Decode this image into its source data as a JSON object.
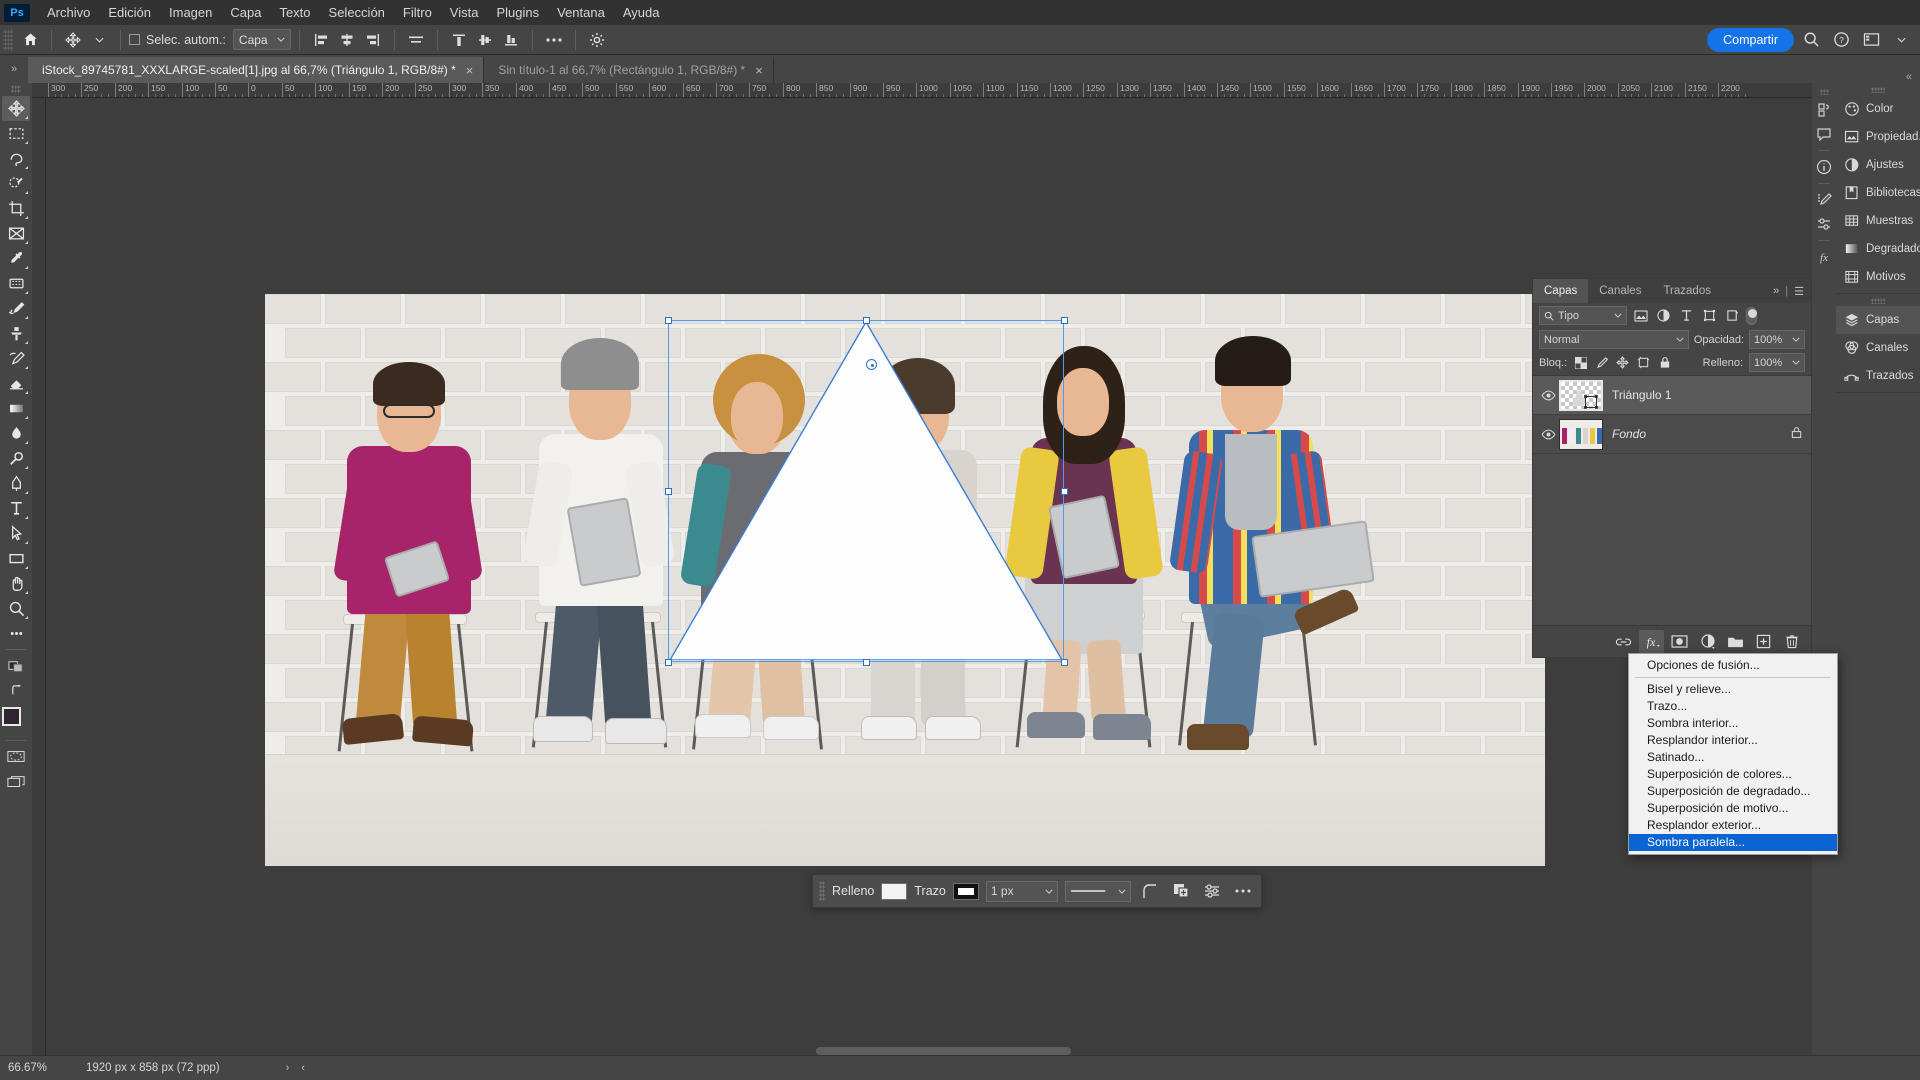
{
  "app": {
    "logo": "Ps",
    "share_label": "Compartir"
  },
  "menubar": {
    "items": [
      "Archivo",
      "Edición",
      "Imagen",
      "Capa",
      "Texto",
      "Selección",
      "Filtro",
      "Vista",
      "Plugins",
      "Ventana",
      "Ayuda"
    ]
  },
  "options_bar": {
    "home_icon": "home-icon",
    "tool_icon": "move-tool-icon",
    "auto_select_label": "Selec. autom.:",
    "auto_select_value": "Capa",
    "align_icons": [
      "align-left-icon",
      "align-center-h-icon",
      "align-right-icon",
      "distribute-h-icon",
      "align-top-icon",
      "align-center-v-icon",
      "align-bottom-icon"
    ],
    "more_icon": "more-options-icon",
    "settings_icon": "gear-icon",
    "search_icon": "search-icon",
    "help_icon": "help-icon",
    "workspace_icon": "workspace-icon"
  },
  "tabs": [
    {
      "title": "iStock_89745781_XXXLARGE-scaled[1].jpg al 66,7% (Triángulo 1, RGB/8#) *",
      "active": true,
      "close": "×"
    },
    {
      "title": "Sin título-1 al 66,7% (Rectángulo 1, RGB/8#) *",
      "active": false,
      "close": "×"
    }
  ],
  "toolbar": {
    "tools": [
      {
        "name": "move-tool",
        "glyph": "move",
        "selected": true
      },
      {
        "name": "rectangular-marquee-tool",
        "glyph": "marquee"
      },
      {
        "name": "lasso-tool",
        "glyph": "lasso"
      },
      {
        "name": "object-selection-tool",
        "glyph": "quickselect"
      },
      {
        "name": "crop-tool",
        "glyph": "crop"
      },
      {
        "name": "frame-tool",
        "glyph": "frame"
      },
      {
        "name": "eyedropper-tool",
        "glyph": "eyedropper"
      },
      {
        "name": "spot-healing-brush-tool",
        "glyph": "heal"
      },
      {
        "name": "brush-tool",
        "glyph": "brush"
      },
      {
        "name": "clone-stamp-tool",
        "glyph": "stamp"
      },
      {
        "name": "history-brush-tool",
        "glyph": "historybrush"
      },
      {
        "name": "eraser-tool",
        "glyph": "eraser"
      },
      {
        "name": "gradient-tool",
        "glyph": "gradient"
      },
      {
        "name": "blur-tool",
        "glyph": "blur"
      },
      {
        "name": "dodge-tool",
        "glyph": "dodge"
      },
      {
        "name": "pen-tool",
        "glyph": "pen"
      },
      {
        "name": "type-tool",
        "glyph": "type"
      },
      {
        "name": "path-selection-tool",
        "glyph": "pathselect"
      },
      {
        "name": "rectangle-tool",
        "glyph": "rectangle"
      },
      {
        "name": "hand-tool",
        "glyph": "hand"
      },
      {
        "name": "zoom-tool",
        "glyph": "zoom"
      },
      {
        "name": "edit-toolbar",
        "glyph": "ellipsis"
      }
    ],
    "foreground_color": "#2f2430",
    "background_color": "#fae13c"
  },
  "ruler": {
    "labels": [
      "300",
      "250",
      "200",
      "150",
      "100",
      "50",
      "0",
      "50",
      "100",
      "150",
      "200",
      "250",
      "300",
      "350",
      "400",
      "450",
      "500",
      "550",
      "600",
      "650",
      "700",
      "750",
      "800",
      "850",
      "900",
      "950",
      "1000",
      "1050",
      "1100",
      "1150",
      "1200",
      "1250",
      "1300",
      "1350",
      "1400",
      "1450",
      "1500",
      "1550",
      "1600",
      "1650",
      "1700",
      "1750",
      "1800",
      "1850",
      "1900",
      "1950",
      "2000",
      "2050",
      "2100",
      "2150",
      "2200"
    ]
  },
  "shape_options_bar": {
    "fill_label": "Relleno",
    "fill_color": "#f4f4f4",
    "stroke_label": "Trazo",
    "stroke_color": "#111111",
    "stroke_width": "1 px",
    "stroke_style_icon": "stroke-style-icon",
    "corner_icon": "corner-radius-icon",
    "path-ops_icon": "path-operations-icon",
    "align_icon": "path-align-icon",
    "more_icon": "more-shape-options-icon"
  },
  "dock": {
    "groups": [
      {
        "items": [
          {
            "label": "Color",
            "icon": "color-palette-icon"
          },
          {
            "label": "Propiedad...",
            "icon": "properties-icon"
          },
          {
            "label": "Ajustes",
            "icon": "adjustments-icon"
          },
          {
            "label": "Bibliotecas",
            "icon": "libraries-icon"
          },
          {
            "label": "Muestras",
            "icon": "swatches-icon"
          },
          {
            "label": "Degradados",
            "icon": "gradients-icon"
          },
          {
            "label": "Motivos",
            "icon": "patterns-icon"
          }
        ]
      },
      {
        "items": [
          {
            "label": "Capas",
            "icon": "layers-icon",
            "active": true
          },
          {
            "label": "Canales",
            "icon": "channels-icon"
          },
          {
            "label": "Trazados",
            "icon": "paths-icon"
          }
        ]
      }
    ]
  },
  "rail": {
    "icons": [
      "history-icon",
      "comments-icon",
      "info-icon",
      "brush-settings-icon",
      "adjust-sliders-icon",
      "fx-icon"
    ]
  },
  "layers_panel": {
    "tabs": [
      "Capas",
      "Canales",
      "Trazados"
    ],
    "active_tab": "Capas",
    "collapse_icon": "chevron-right-icon",
    "menu_icon": "panel-menu-icon",
    "filter": {
      "search_icon": "search-icon",
      "value": "Tipo",
      "icons": [
        "filter-image-icon",
        "filter-adjustment-icon",
        "filter-type-icon",
        "filter-shape-icon",
        "filter-smart-icon"
      ],
      "toggle": "filter-toggle"
    },
    "blend_mode": "Normal",
    "opacity_label": "Opacidad:",
    "opacity_value": "100%",
    "lock_label": "Bloq.:",
    "lock_icons": [
      "lock-transparency-icon",
      "lock-image-icon",
      "lock-position-icon",
      "lock-artboard-icon",
      "lock-all-icon"
    ],
    "fill_label": "Relleno:",
    "fill_value": "100%",
    "layers": [
      {
        "name": "Triángulo 1",
        "selected": true,
        "visible": true,
        "locked": false,
        "thumb": "shape"
      },
      {
        "name": "Fondo",
        "selected": false,
        "visible": true,
        "locked": true,
        "thumb": "photo",
        "italic": true
      }
    ],
    "footer_buttons": [
      {
        "name": "link-layers-button",
        "icon": "link-icon"
      },
      {
        "name": "layer-style-button",
        "icon": "fx-icon",
        "active": true
      },
      {
        "name": "layer-mask-button",
        "icon": "mask-icon"
      },
      {
        "name": "adjustment-layer-button",
        "icon": "half-circle-icon"
      },
      {
        "name": "new-group-button",
        "icon": "folder-icon"
      },
      {
        "name": "new-layer-button",
        "icon": "plus-square-icon"
      },
      {
        "name": "delete-layer-button",
        "icon": "trash-icon"
      }
    ]
  },
  "context_menu": {
    "items": [
      {
        "label": "Opciones de fusión...",
        "sep_after": true
      },
      {
        "label": "Bisel y relieve..."
      },
      {
        "label": "Trazo..."
      },
      {
        "label": "Sombra interior..."
      },
      {
        "label": "Resplandor interior..."
      },
      {
        "label": "Satinado..."
      },
      {
        "label": "Superposición de colores..."
      },
      {
        "label": "Superposición de degradado..."
      },
      {
        "label": "Superposición de motivo..."
      },
      {
        "label": "Resplandor exterior..."
      },
      {
        "label": "Sombra paralela...",
        "highlighted": true
      }
    ]
  },
  "status_bar": {
    "zoom": "66.67%",
    "doc_size": "1920 px x 858 px (72 ppp)",
    "next_arrow": "›",
    "prev_arrow": "‹"
  }
}
